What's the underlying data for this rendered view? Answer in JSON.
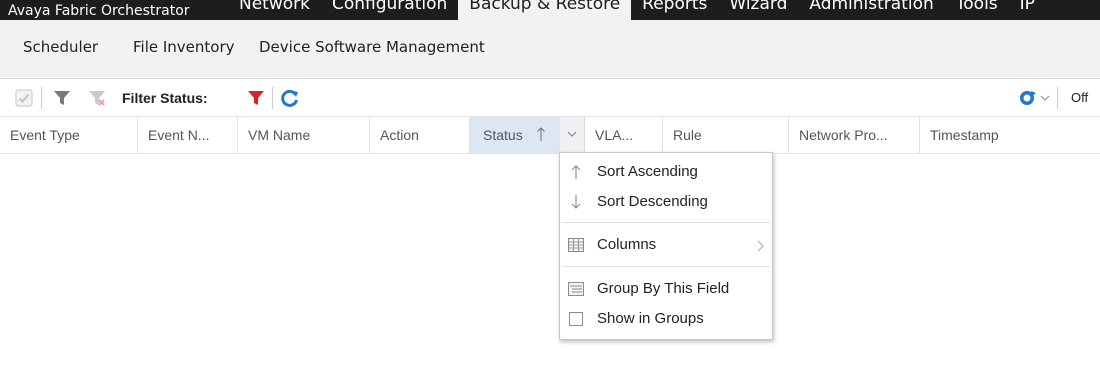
{
  "app": {
    "title": "Avaya Fabric Orchestrator",
    "nav_tabs": [
      {
        "label": "Network",
        "active": false
      },
      {
        "label": "Configuration",
        "active": false
      },
      {
        "label": "Backup & Restore",
        "active": true
      },
      {
        "label": "Reports",
        "active": false
      },
      {
        "label": "Wizard",
        "active": false
      },
      {
        "label": "Administration",
        "active": false
      },
      {
        "label": "Tools",
        "active": false
      },
      {
        "label": "IP",
        "active": false
      }
    ]
  },
  "subnav": {
    "items": [
      "Scheduler",
      "File Inventory",
      "Device Software Management"
    ]
  },
  "toolbar": {
    "filter_status_label": "Filter Status:",
    "off_label": "Off",
    "icons": [
      "checkbox-icon",
      "filter-icon",
      "clear-filter-icon",
      "filter-active-icon",
      "refresh-icon",
      "auto-refresh-icon"
    ]
  },
  "grid": {
    "columns": [
      {
        "label": "Event Type"
      },
      {
        "label": "Event N..."
      },
      {
        "label": "VM Name"
      },
      {
        "label": "Action"
      },
      {
        "label": "Status",
        "sort": "ascending"
      },
      {
        "label": "VLA..."
      },
      {
        "label": "Rule"
      },
      {
        "label": "Network Pro..."
      },
      {
        "label": "Timestamp"
      }
    ],
    "rows": []
  },
  "column_menu": {
    "items": [
      {
        "label": "Sort Ascending",
        "icon": "arrow-up-icon"
      },
      {
        "label": "Sort Descending",
        "icon": "arrow-down-icon"
      },
      {
        "label": "Columns",
        "icon": "columns-icon",
        "submenu": true
      },
      {
        "label": "Group By This Field",
        "icon": "group-icon"
      },
      {
        "label": "Show in Groups",
        "icon": "checkbox-icon",
        "checked": false
      }
    ]
  },
  "colors": {
    "topbar": "#1d1d1d",
    "subnav": "#f2f2f2",
    "sorted_header": "#dde7f3",
    "filter_red": "#d9202b",
    "refresh_blue": "#1f78c8"
  }
}
